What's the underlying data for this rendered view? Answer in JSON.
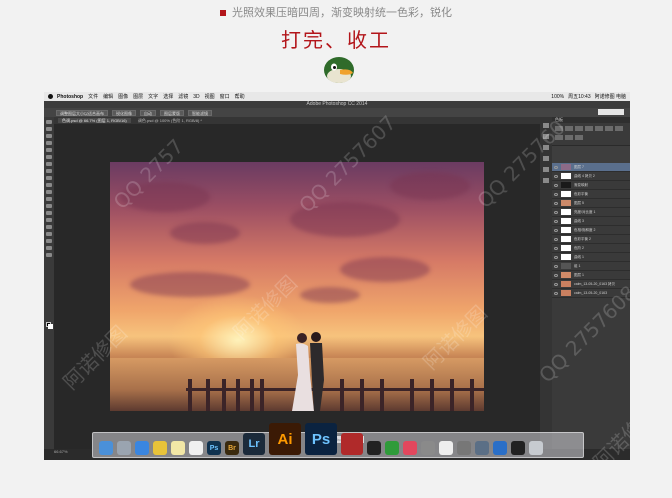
{
  "caption": "光照效果压暗四周，渐变映射统一色彩，锐化",
  "heading": "打完、收工",
  "menubar": {
    "app": "Photoshop",
    "items": [
      "文件",
      "编辑",
      "图像",
      "图层",
      "文字",
      "选择",
      "滤镜",
      "3D",
      "视图",
      "窗口",
      "帮助"
    ],
    "status": [
      "100%",
      "周五10:43",
      "阿诺修图 电脑"
    ]
  },
  "window_title": "Adobe Photoshop CC 2014",
  "options_bar": [
    "调整图层大小以适合画布",
    "锐化图像",
    "自动",
    "图层蒙版",
    "智能滤镜"
  ],
  "doc_tab": {
    "active": "色调.psd @ 66.7% (图层 1, RGB/16)",
    "other": "调色.psd @ 100% (色阶 1, RGB/8) *"
  },
  "layers": [
    {
      "name": "图层 7",
      "sel": true
    },
    {
      "name": "曲线 4 拷贝 2"
    },
    {
      "name": "渐变映射"
    },
    {
      "name": "色彩平衡"
    },
    {
      "name": "图层 5"
    },
    {
      "name": "亮度/对比度 1"
    },
    {
      "name": "曲线 3"
    },
    {
      "name": "色相/饱和度 2"
    },
    {
      "name": "色彩平衡 2"
    },
    {
      "name": "色阶 2"
    },
    {
      "name": "曲线 1"
    },
    {
      "name": "组 1"
    },
    {
      "name": "图层 1"
    },
    {
      "name": "calm_13-05-20_0163 拷贝"
    },
    {
      "name": "calm_13-05-20_0163"
    }
  ],
  "panel_title": "色板",
  "tooltip": "Adobe Photoshop CC 2014",
  "status_zoom": "66.67%",
  "dock": [
    {
      "name": "finder",
      "label": "",
      "color": "#4a90d9"
    },
    {
      "name": "launchpad",
      "label": "",
      "color": "#9aa4b0"
    },
    {
      "name": "safari",
      "label": "",
      "color": "#3a86e0"
    },
    {
      "name": "chrome",
      "label": "",
      "color": "#e8c33a"
    },
    {
      "name": "notes",
      "label": "",
      "color": "#f2e7a6"
    },
    {
      "name": "calendar",
      "label": "",
      "color": "#f0f0f0"
    },
    {
      "name": "ps-small",
      "label": "Ps",
      "color": "#10324f"
    },
    {
      "name": "bridge",
      "label": "Br",
      "color": "#3a2a0e"
    },
    {
      "name": "lightroom",
      "label": "Lr",
      "color": "#1b2a3a"
    },
    {
      "name": "illustrator",
      "label": "Ai",
      "color": "#3b1a05"
    },
    {
      "name": "photoshop",
      "label": "Ps",
      "color": "#0b2340"
    },
    {
      "name": "photo-booth",
      "label": "",
      "color": "#b02a2a"
    },
    {
      "name": "camera",
      "label": "",
      "color": "#222222"
    },
    {
      "name": "numbers",
      "label": "",
      "color": "#2f9b3a"
    },
    {
      "name": "itunes",
      "label": "",
      "color": "#e2475d"
    },
    {
      "name": "preview",
      "label": "",
      "color": "#8a8a8a"
    },
    {
      "name": "textedit",
      "label": "",
      "color": "#eeeeee"
    },
    {
      "name": "system-prefs",
      "label": "",
      "color": "#777777"
    },
    {
      "name": "monitor",
      "label": "",
      "color": "#5b6f86"
    },
    {
      "name": "app-store",
      "label": "",
      "color": "#2a6fc7"
    },
    {
      "name": "qq",
      "label": "",
      "color": "#222222"
    },
    {
      "name": "trash",
      "label": "",
      "color": "#c7cbd0"
    }
  ],
  "watermarks": [
    "QQ 2757",
    "阿诺修图",
    "QQ 2757607",
    "阿诺修图",
    "QQ 275760",
    "阿诺修图",
    "QQ 2757608",
    "阿诺修图"
  ]
}
